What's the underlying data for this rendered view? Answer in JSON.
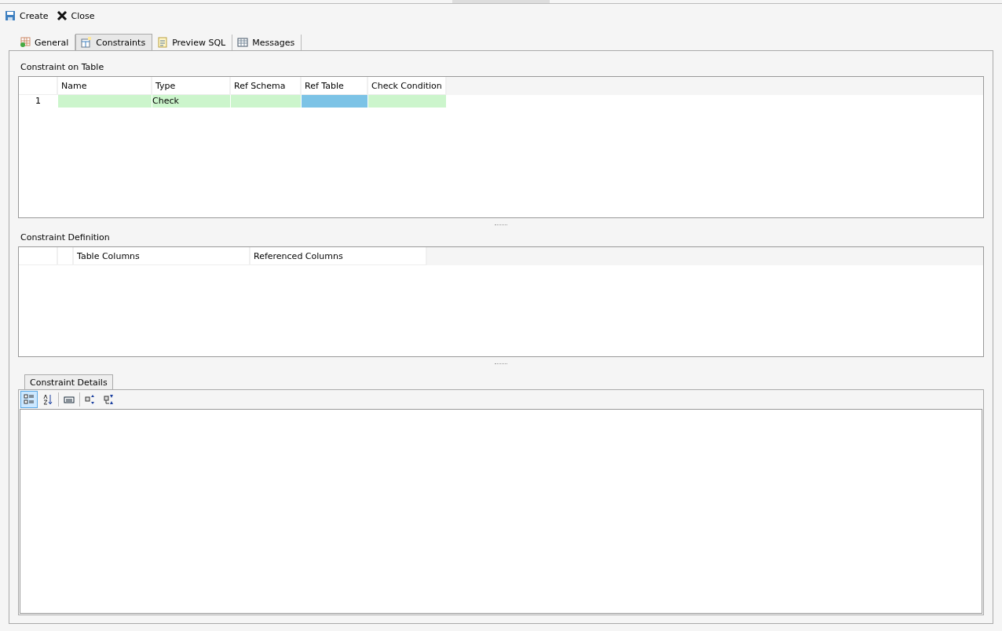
{
  "toolbar": [
    {
      "kind": "save",
      "label": "Create"
    },
    {
      "kind": "close",
      "label": "Close"
    }
  ],
  "tabs": [
    {
      "kind": "general",
      "label": "General",
      "selected": false
    },
    {
      "kind": "constraints",
      "label": "Constraints",
      "selected": true
    },
    {
      "kind": "sql",
      "label": "Preview SQL",
      "selected": false
    },
    {
      "kind": "messages",
      "label": "Messages",
      "selected": false
    }
  ],
  "constraint_table": {
    "title": "Constraint on Table",
    "columns": [
      "Name",
      "Type",
      "Ref Schema",
      "Ref Table",
      "Check Condition"
    ],
    "rows": [
      {
        "number": "1",
        "cells": [
          {
            "selected": false
          },
          {
            "text": "Check",
            "selected": false
          },
          {
            "selected": false
          },
          {
            "selected": true
          },
          {
            "selected": false
          }
        ]
      }
    ]
  },
  "definition_table": {
    "title": "Constraint Definition",
    "columns": [
      "Table Columns",
      "Referenced Columns"
    ]
  },
  "details": {
    "tab": "Constraint Details",
    "tools": [
      {
        "kind": "categorized",
        "selected": true
      },
      {
        "kind": "alphabetical",
        "selected": false
      },
      {
        "kind": "pages",
        "selected": false
      },
      {
        "kind": "expand",
        "selected": false
      },
      {
        "kind": "collapse",
        "selected": false
      }
    ]
  }
}
